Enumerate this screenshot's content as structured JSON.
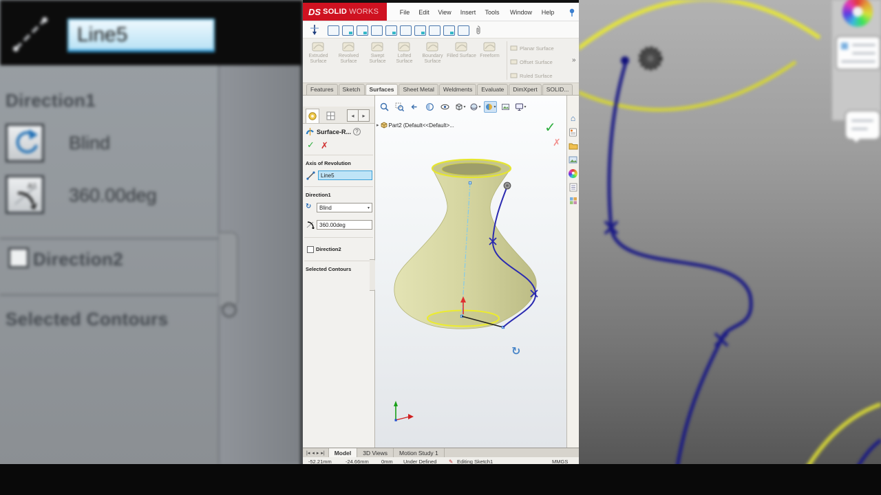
{
  "colors": {
    "brand_red": "#cf1221",
    "selection_blue": "#bfe4f7",
    "sketch_yellow": "#e8e22e",
    "spline_blue": "#2a2ab0",
    "vase_fill": "#d2d29c"
  },
  "icons": {
    "caret_down": "▾",
    "chevron_overflow": "»",
    "help": "?",
    "ok_check": "✓",
    "cancel_x": "✗",
    "tab_prev": "◂",
    "tab_next": "▸",
    "tree_expand": "▸",
    "home": "⌂",
    "rotate": "↻",
    "pencil": "✎",
    "nav_first": "|◂",
    "nav_prev": "◂",
    "nav_next": "▸",
    "nav_last": "▸|"
  },
  "left": {
    "field_value": "Line5",
    "direction1": "Direction1",
    "blind": "Blind",
    "angle": "360.00deg",
    "direction2": "Direction2",
    "selected_contours": "Selected Contours"
  },
  "app": {
    "titlebar": {
      "logo_ds": "DS",
      "brand_a": "SOLID",
      "brand_b": "WORKS",
      "menu": [
        "File",
        "Edit",
        "View",
        "Insert",
        "Tools",
        "Window",
        "Help"
      ]
    },
    "ribbon": {
      "tools": [
        "Extruded Surface",
        "Revolved Surface",
        "Swept Surface",
        "Lofted Surface",
        "Boundary Surface",
        "Filled Surface",
        "Freeform"
      ],
      "side_tools": [
        "Planar Surface",
        "Offset Surface",
        "Ruled Surface"
      ]
    },
    "tabs": [
      "Features",
      "Sketch",
      "Surfaces",
      "Sheet Metal",
      "Weldments",
      "Evaluate",
      "DimXpert",
      "SOLID..."
    ],
    "pm": {
      "title": "Surface-R...",
      "axis_header": "Axis of Revolution",
      "axis_value": "Line5",
      "dir1_header": "Direction1",
      "dir1_type": "Blind",
      "dir1_angle": "360.00deg",
      "dir2_label": "Direction2",
      "contours_header": "Selected Contours"
    },
    "tree_root": "Part2  (Default<<Default>...",
    "bottom_tabs": [
      "Model",
      "3D Views",
      "Motion Study 1"
    ],
    "status": {
      "x": "-52.21mm",
      "y": "-24.66mm",
      "z": "0mm",
      "state": "Under Defined",
      "mode": "Editing Sketch1",
      "units": "MMGS"
    }
  }
}
